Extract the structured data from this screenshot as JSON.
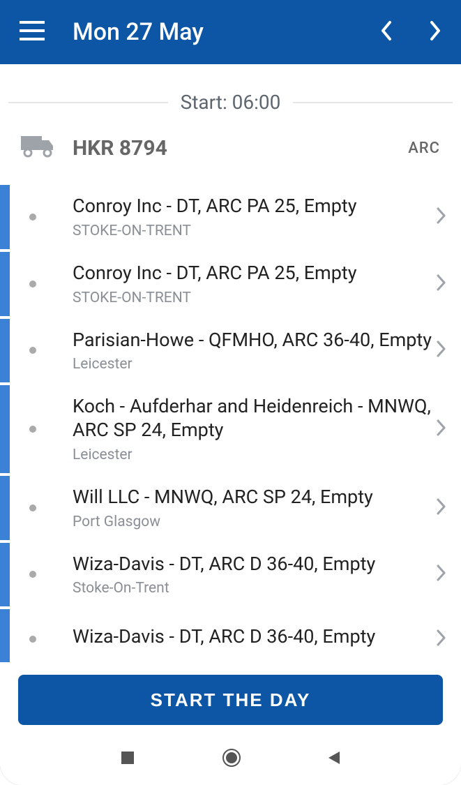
{
  "header": {
    "title": "Mon 27 May"
  },
  "start_label": "Start: 06:00",
  "vehicle": {
    "registration": "HKR 8794",
    "code": "ARC"
  },
  "jobs": [
    {
      "title": "Conroy Inc - DT, ARC PA 25, Empty",
      "location": "STOKE-ON-TRENT"
    },
    {
      "title": "Conroy Inc - DT, ARC PA 25, Empty",
      "location": "STOKE-ON-TRENT"
    },
    {
      "title": "Parisian-Howe - QFMHO, ARC 36-40, Empty",
      "location": "Leicester"
    },
    {
      "title": "Koch - Aufderhar and Heidenreich - MNWQ, ARC SP 24, Empty",
      "location": "Leicester"
    },
    {
      "title": "Will LLC - MNWQ, ARC SP 24, Empty",
      "location": "Port Glasgow"
    },
    {
      "title": "Wiza-Davis - DT, ARC D 36-40, Empty",
      "location": "Stoke-On-Trent"
    },
    {
      "title": "Wiza-Davis - DT, ARC D 36-40, Empty",
      "location": ""
    }
  ],
  "footer": {
    "start_button": "START THE DAY"
  }
}
